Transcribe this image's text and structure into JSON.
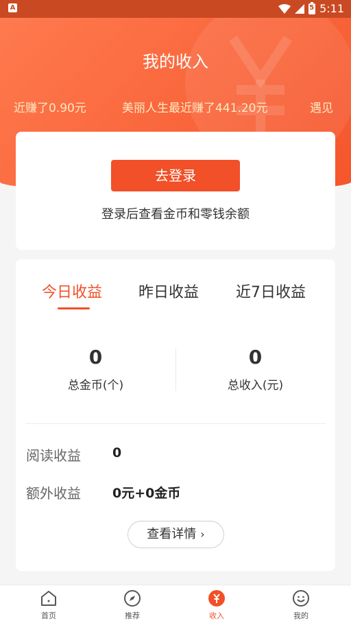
{
  "statusbar": {
    "time": "5:11",
    "left_badge": "A",
    "battery_digit": "5"
  },
  "header": {
    "title": "我的收入"
  },
  "ticker": {
    "items": [
      "近赚了0.90元",
      "美丽人生最近赚了441.20元",
      "遇见"
    ]
  },
  "login": {
    "button_label": "去登录",
    "hint": "登录后查看金币和零钱余额"
  },
  "tabs": [
    {
      "label": "今日收益",
      "active": true
    },
    {
      "label": "昨日收益",
      "active": false
    },
    {
      "label": "近7日收益",
      "active": false
    }
  ],
  "stats": [
    {
      "value": "0",
      "label": "总金币(个)"
    },
    {
      "value": "0",
      "label": "总收入(元)"
    }
  ],
  "rows": [
    {
      "label": "阅读收益",
      "value": "0"
    },
    {
      "label": "额外收益",
      "value": "0元+0金币"
    }
  ],
  "detail_button": {
    "label": "查看详情",
    "chevron": "›"
  },
  "bottom_nav": [
    {
      "label": "首页",
      "icon": "home-icon",
      "active": false
    },
    {
      "label": "推荐",
      "icon": "compass-icon",
      "active": false
    },
    {
      "label": "收入",
      "icon": "yen-icon",
      "active": true
    },
    {
      "label": "我的",
      "icon": "smile-icon",
      "active": false
    }
  ],
  "colors": {
    "accent": "#f15028",
    "header_start": "#ff7a4f",
    "header_end": "#f5552b",
    "ticker_text": "#ffe9c2"
  }
}
